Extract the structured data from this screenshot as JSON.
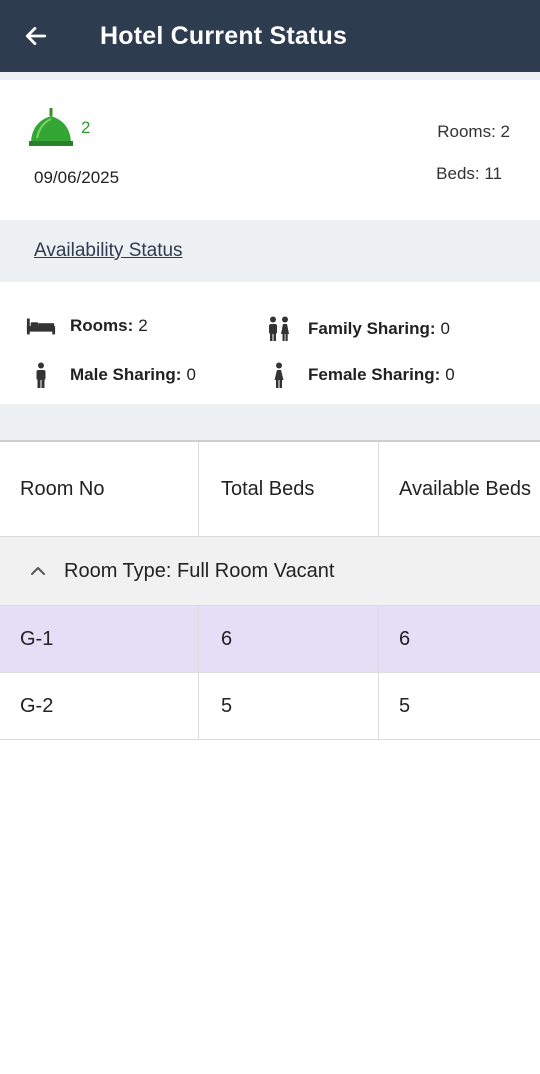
{
  "appbar": {
    "title": "Hotel Current Status"
  },
  "summary": {
    "count": "2",
    "date": "09/06/2025",
    "rooms": "Rooms: 2",
    "beds": "Beds: 11"
  },
  "availability": {
    "heading": "Availability Status",
    "stats": {
      "rooms": {
        "label": "Rooms:",
        "value": "2"
      },
      "family": {
        "label": "Family Sharing:",
        "value": "0"
      },
      "male": {
        "label": "Male Sharing:",
        "value": "0"
      },
      "female": {
        "label": "Female Sharing:",
        "value": "0"
      }
    }
  },
  "table": {
    "headers": [
      "Room No",
      "Total Beds",
      "Available Beds"
    ],
    "group": "Room Type: Full Room Vacant",
    "rows": [
      {
        "room": "G-1",
        "total": "6",
        "available": "6"
      },
      {
        "room": "G-2",
        "total": "5",
        "available": "5"
      }
    ]
  },
  "colors": {
    "appbar": "#2d3c4f",
    "selected_row": "#e6def7",
    "accent_green": "#2e9b2e"
  },
  "icons": [
    "arrow-left-icon",
    "dome-icon",
    "bed-icon",
    "family-icon",
    "male-icon",
    "female-icon",
    "chevron-up-icon"
  ]
}
